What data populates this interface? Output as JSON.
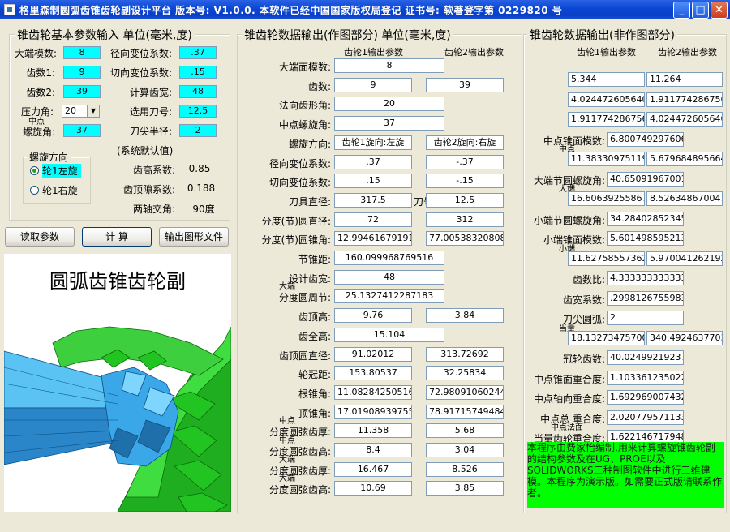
{
  "titlebar": {
    "text": "格里森制圆弧齿锥齿轮副设计平台 版本号: V1.0.0. 本软件已经中国国家版权局登记 证书号: 软著登字第 0229820 号"
  },
  "input_panel": {
    "title": "锥齿轮基本参数输入 单位(毫米,度)",
    "end_module_label": "大端模数:",
    "end_module": "8",
    "z1_label": "齿数1:",
    "z1": "9",
    "z2_label": "齿数2:",
    "z2": "39",
    "pressure_label": "压力角:",
    "pressure": "20",
    "mid_label_top": "中点",
    "mid_label_bottom": "螺旋角:",
    "mid_helix": "37",
    "radial_label": "径向变位系数:",
    "radial": ".37",
    "tangential_label": "切向变位系数:",
    "tangential": ".15",
    "face_width_label": "计算齿宽:",
    "face_width": "48",
    "cutter_label": "选用刀号:",
    "cutter": "12.5",
    "tip_radius_label": "刀尖半径:",
    "tip_radius": "2",
    "default_title": "(系统默认值)",
    "addendum_coef_label": "齿高系数:",
    "addendum_coef": "0.85",
    "clearance_coef_label": "齿顶隙系数:",
    "clearance_coef": "0.188",
    "shaft_angle_label": "两轴交角:",
    "shaft_angle": "90度",
    "helix_dir": {
      "title": "螺旋方向",
      "left": "轮1左旋",
      "right": "轮1右旋"
    }
  },
  "buttons": {
    "read": "读取参数",
    "calc": "计 算",
    "output": "输出图形文件"
  },
  "image_title": "圆弧齿锥齿轮副",
  "mid_panel": {
    "title": "锥齿轮数据输出(作图部分) 单位(毫米,度)",
    "col1": "齿轮1输出参数",
    "col2": "齿轮2输出参数",
    "rows": [
      {
        "label": "大端面模数:",
        "v": "8"
      },
      {
        "label": "齿数:",
        "v1": "9",
        "v2": "39"
      },
      {
        "label": "法向齿形角:",
        "v": "20"
      },
      {
        "label": "中点螺旋角:",
        "v": "37"
      },
      {
        "label": "螺旋方向:",
        "v1": "齿轮1旋向:左旋",
        "v2": "齿轮2旋向:右旋"
      },
      {
        "label": "径向变位系数:",
        "v1": ".37",
        "v2": "-.37"
      },
      {
        "label": "切向变位系数:",
        "v1": ".15",
        "v2": "-.15"
      },
      {
        "label": "刀具直径:",
        "v1": "317.5",
        "mid": "刀号:",
        "v2": "12.5"
      },
      {
        "label": "分度(节)圆直径:",
        "v1": "72",
        "v2": "312"
      },
      {
        "label": "分度(节)圆锥角:",
        "v1": "12.994616791916",
        "v2": "77.005383208083"
      },
      {
        "label": "节锥距:",
        "v": "160.099968769516"
      },
      {
        "label": "设计齿宽:",
        "v": "48"
      },
      {
        "label_top": "大端",
        "label": "分度圆周节:",
        "v": "25.1327412287183"
      },
      {
        "label": "齿顶高:",
        "v1": "9.76",
        "v2": "3.84"
      },
      {
        "label": "齿全高:",
        "v": "15.104"
      },
      {
        "label": "齿顶圆直径:",
        "v1": "91.02012",
        "v2": "313.72692"
      },
      {
        "label": "轮冠距:",
        "v1": "153.80537",
        "v2": "32.25834"
      },
      {
        "label": "根锥角:",
        "v1": "11.08284250516",
        "v2": "72.980910602443"
      },
      {
        "label": "顶锥角:",
        "v1": "17.019089397556",
        "v2": "78.91715749484"
      },
      {
        "label_top": "中点",
        "label": "分度圆弦齿厚:",
        "v1": "11.358",
        "v2": "5.68"
      },
      {
        "label_top": "中点",
        "label": "分度圆弦齿高:",
        "v1": "8.4",
        "v2": "3.04"
      },
      {
        "label_top": "大端",
        "label": "分度圆弦齿厚:",
        "v1": "16.467",
        "v2": "8.526"
      },
      {
        "label_top": "大端",
        "label": "分度圆弦齿高:",
        "v1": "10.69",
        "v2": "3.85"
      }
    ]
  },
  "right_panel": {
    "title": "锥齿轮数据输出(非作图部分)",
    "col1": "齿轮1输出参数",
    "col2": "齿轮2输出参数",
    "rows": [
      {
        "label": "齿根高:",
        "v1": "5.344",
        "v2": "11.264"
      },
      {
        "label": "齿顶角:",
        "v1": "4.0244726056402",
        "v2": "1.9117742867565"
      },
      {
        "label": "齿根角:",
        "v1": "1.9117742867565",
        "v2": "4.0244726056402"
      },
      {
        "label": "中点锥面模数:",
        "v": "6.8007492976066"
      },
      {
        "label_top": "中点",
        "label": "弧齿厚:",
        "v1": "11.383309751199",
        "v2": "5.6796848956645"
      },
      {
        "label": "大端节圆螺旋角:",
        "v": "40.650919670019"
      },
      {
        "label_top": "大端",
        "label": "弧齿厚:",
        "v1": "16.606392558676",
        "v2": "8.5263486700415"
      },
      {
        "label": "小端节圆螺旋角:",
        "v": "34.284028523459"
      },
      {
        "label": "小端锥面模数:",
        "v": "5.6014985952132"
      },
      {
        "label_top": "小端",
        "label": "弧齿厚:",
        "v1": "11.627585573623",
        "v2": "5.970041262192"
      },
      {
        "label": "齿数比:",
        "v": "4.3333333333333"
      },
      {
        "label": "齿宽系数:",
        "v": ".29981267559834"
      },
      {
        "label": "刀尖圆弧:",
        "v": "2"
      },
      {
        "label_top": "当量",
        "label": "齿数:",
        "v1": "18.132734757003",
        "v2": "340.49246377039"
      },
      {
        "label": "冠轮齿数:",
        "v": "40.024992192379"
      },
      {
        "label": "中点锥面重合度:",
        "v": "1.1033612350228"
      },
      {
        "label": "中点轴向重合度:",
        "v": "1.6929690074325"
      },
      {
        "label": "中点总 重合度:",
        "v": "2.0207795711339"
      },
      {
        "label_top": "中点法面",
        "label": "当量齿轮重合度:",
        "v": "1.6221467179488"
      }
    ],
    "note": "本程序由费家怡编制,用来计算螺旋锥齿轮副的结构参数及在UG、PROE以及SOLIDWORKS三种制图软件中进行三维建模。本程序为演示版。如需要正式版请联系作者。"
  }
}
